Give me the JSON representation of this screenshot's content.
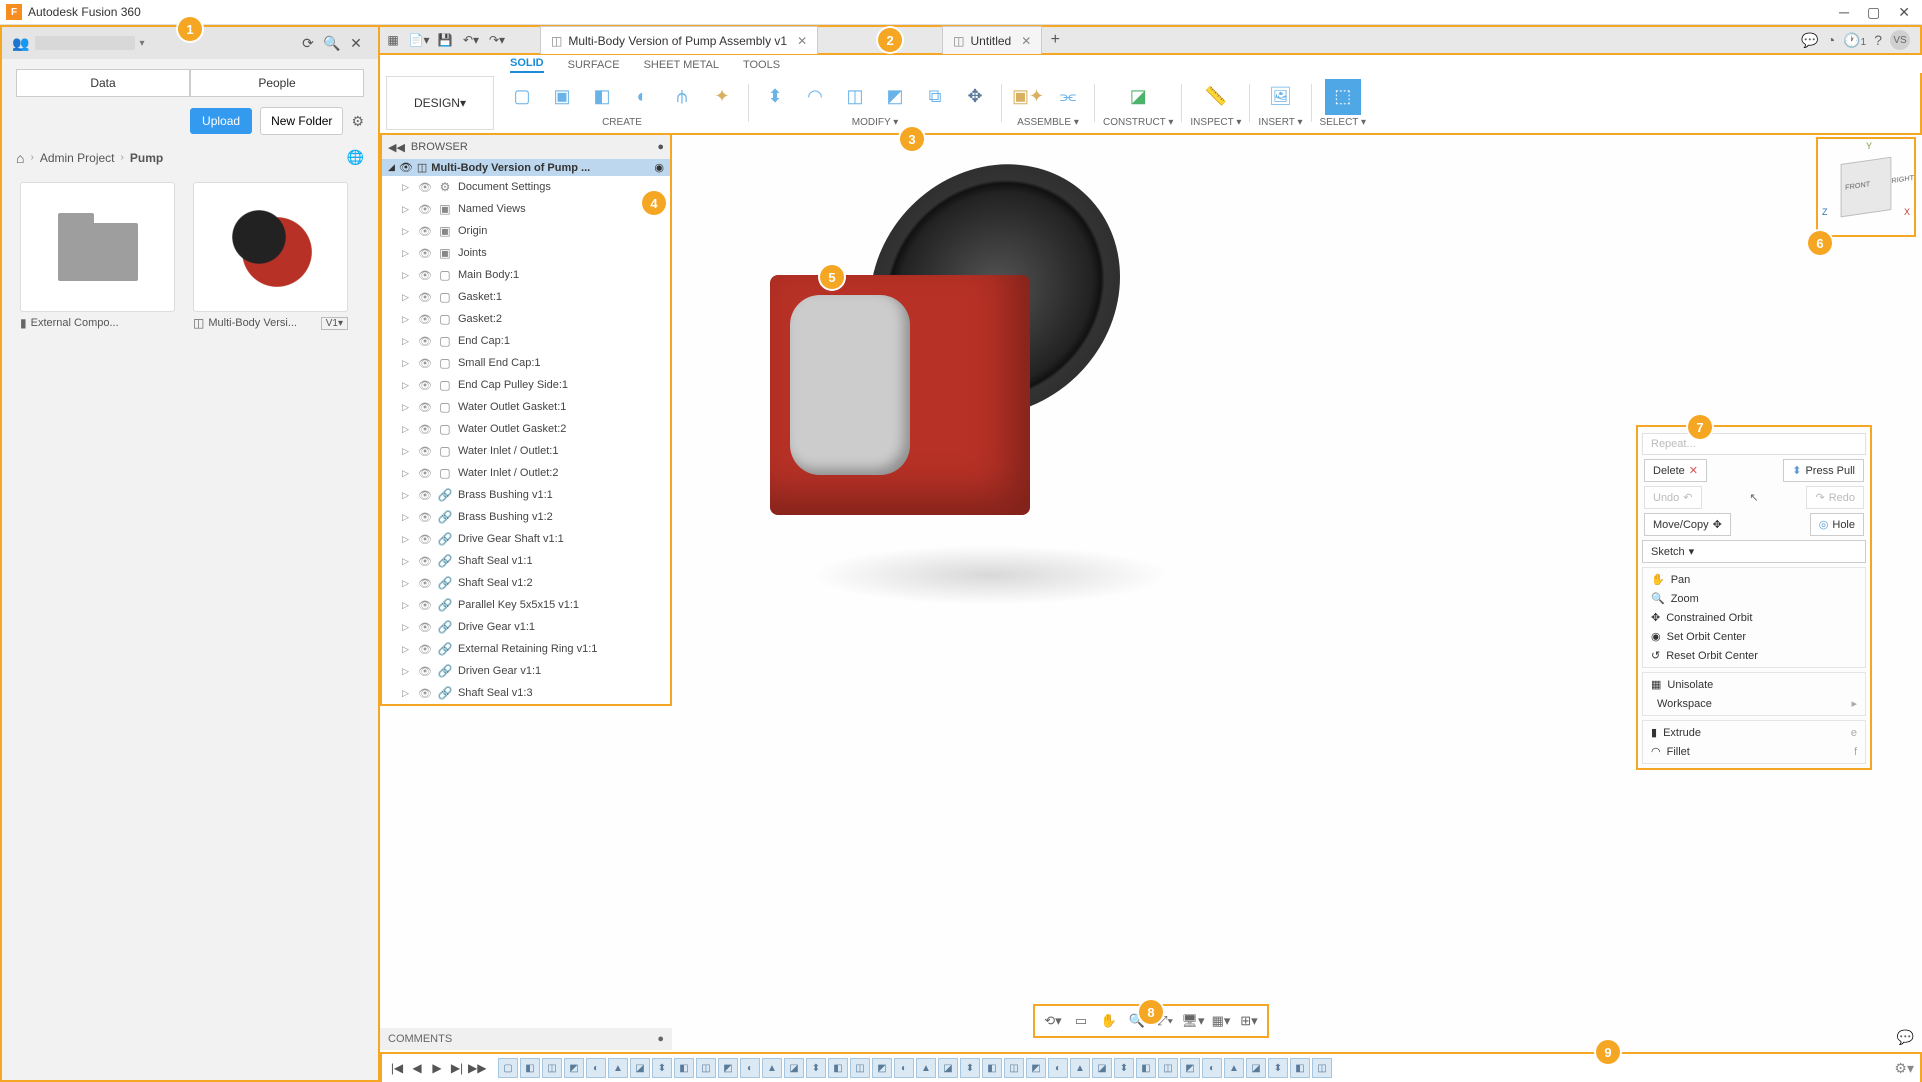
{
  "window": {
    "title": "Autodesk Fusion 360"
  },
  "data_panel": {
    "tabs": {
      "data": "Data",
      "people": "People"
    },
    "upload": "Upload",
    "new_folder": "New Folder",
    "breadcrumb": {
      "project": "Admin Project",
      "folder": "Pump"
    },
    "files": [
      {
        "name": "External Compo...",
        "type": "folder"
      },
      {
        "name": "Multi-Body Versi...",
        "type": "model",
        "version": "V1"
      }
    ]
  },
  "doc_tabs": [
    {
      "title": "Multi-Body Version of Pump Assembly v1",
      "active": true
    },
    {
      "title": "Untitled",
      "active": false
    }
  ],
  "job_badge": "1",
  "avatar": "VS",
  "workspace": "DESIGN",
  "design_tabs": [
    "SOLID",
    "SURFACE",
    "SHEET METAL",
    "TOOLS"
  ],
  "tool_groups": {
    "create": "CREATE",
    "modify": "MODIFY",
    "assemble": "ASSEMBLE",
    "construct": "CONSTRUCT",
    "inspect": "INSPECT",
    "insert": "INSERT",
    "select": "SELECT"
  },
  "browser": {
    "title": "BROWSER",
    "root": "Multi-Body Version of Pump ...",
    "items": [
      {
        "icon": "gear",
        "name": "Document Settings"
      },
      {
        "icon": "folder",
        "name": "Named Views"
      },
      {
        "icon": "folder",
        "name": "Origin"
      },
      {
        "icon": "folder",
        "name": "Joints"
      },
      {
        "icon": "body",
        "name": "Main Body:1"
      },
      {
        "icon": "body",
        "name": "Gasket:1"
      },
      {
        "icon": "body",
        "name": "Gasket:2"
      },
      {
        "icon": "body",
        "name": "End Cap:1"
      },
      {
        "icon": "body",
        "name": "Small End Cap:1"
      },
      {
        "icon": "body",
        "name": "End Cap Pulley Side:1"
      },
      {
        "icon": "body",
        "name": "Water Outlet Gasket:1"
      },
      {
        "icon": "body",
        "name": "Water Outlet Gasket:2"
      },
      {
        "icon": "body",
        "name": "Water Inlet / Outlet:1"
      },
      {
        "icon": "body",
        "name": "Water Inlet / Outlet:2"
      },
      {
        "icon": "link",
        "name": "Brass Bushing v1:1"
      },
      {
        "icon": "link",
        "name": "Brass Bushing v1:2"
      },
      {
        "icon": "link",
        "name": "Drive Gear Shaft v1:1"
      },
      {
        "icon": "link",
        "name": "Shaft Seal v1:1"
      },
      {
        "icon": "link",
        "name": "Shaft Seal v1:2"
      },
      {
        "icon": "link",
        "name": "Parallel Key 5x5x15 v1:1"
      },
      {
        "icon": "link",
        "name": "Drive Gear v1:1"
      },
      {
        "icon": "link",
        "name": "External Retaining Ring v1:1"
      },
      {
        "icon": "link",
        "name": "Driven Gear v1:1"
      },
      {
        "icon": "link",
        "name": "Shaft Seal v1:3"
      }
    ]
  },
  "marking_menu": {
    "repeat": "Repeat...",
    "delete": "Delete",
    "press_pull": "Press Pull",
    "undo": "Undo",
    "redo": "Redo",
    "move": "Move/Copy",
    "hole": "Hole",
    "sketch": "Sketch",
    "list": [
      {
        "icon": "✋",
        "label": "Pan"
      },
      {
        "icon": "🔍",
        "label": "Zoom"
      },
      {
        "icon": "✥",
        "label": "Constrained Orbit"
      },
      {
        "icon": "◉",
        "label": "Set Orbit Center"
      },
      {
        "icon": "↺",
        "label": "Reset Orbit Center"
      }
    ],
    "list2": [
      {
        "icon": "▦",
        "label": "Unisolate",
        "key": ""
      },
      {
        "icon": "",
        "label": "Workspace",
        "key": "▸"
      }
    ],
    "list3": [
      {
        "icon": "▮",
        "label": "Extrude",
        "key": "e"
      },
      {
        "icon": "◠",
        "label": "Fillet",
        "key": "f"
      }
    ]
  },
  "comments": "COMMENTS",
  "viewcube": {
    "front": "FRONT",
    "right": "RIGHT"
  },
  "callouts": [
    "1",
    "2",
    "3",
    "4",
    "5",
    "6",
    "7",
    "8",
    "9"
  ]
}
